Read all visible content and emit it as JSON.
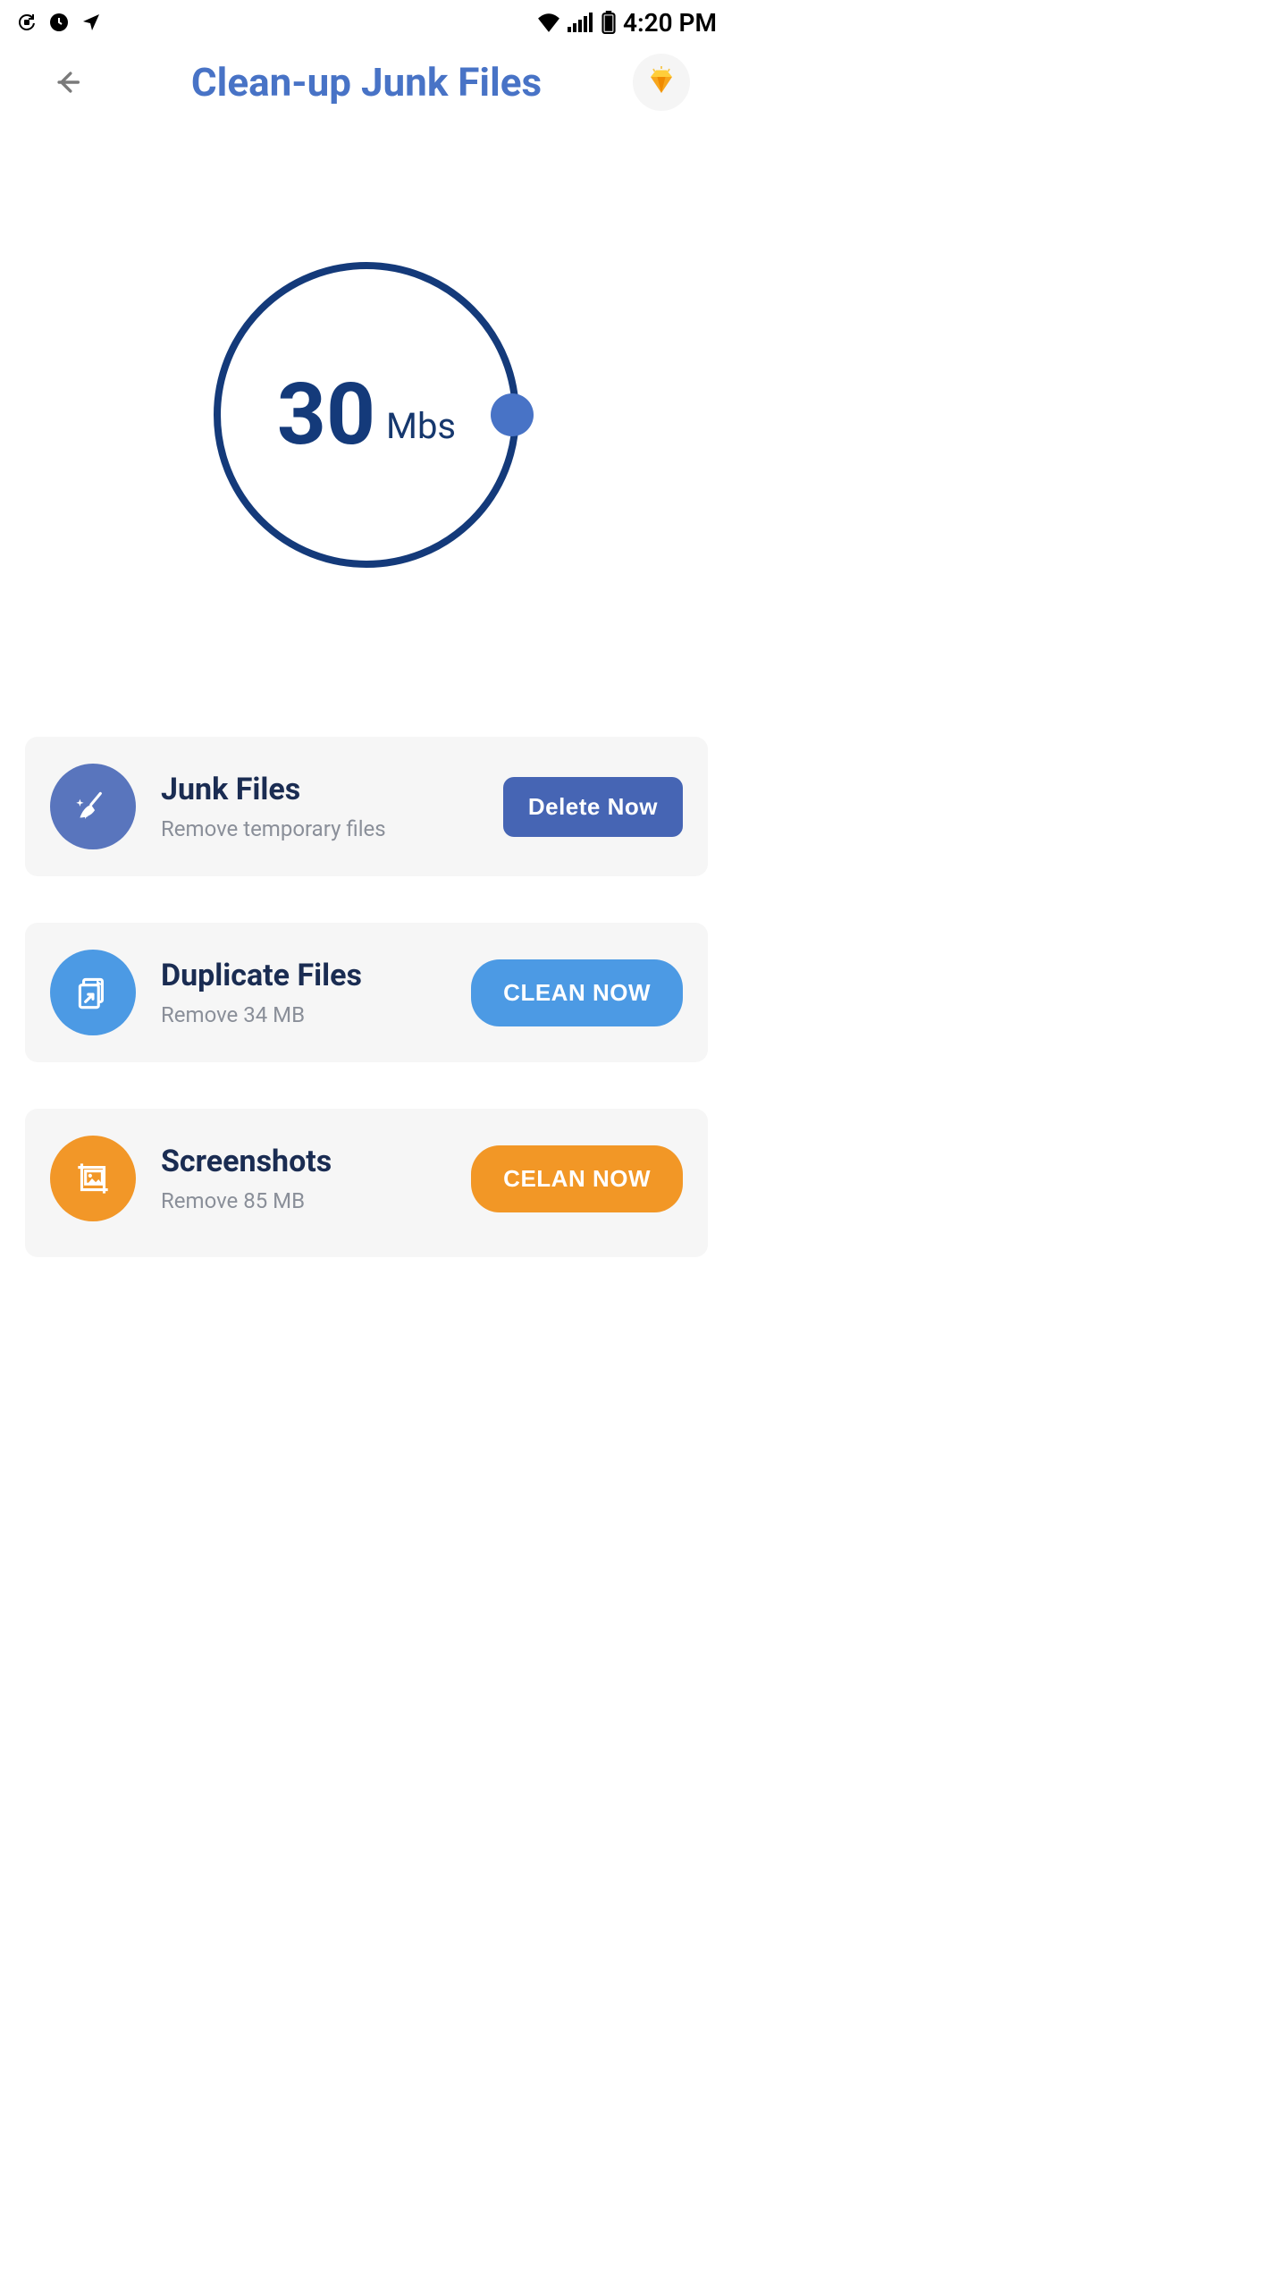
{
  "status_bar": {
    "time": "4:20 PM"
  },
  "header": {
    "title": "Clean-up Junk Files"
  },
  "gauge": {
    "value": "30",
    "unit": "Mbs"
  },
  "cards": [
    {
      "title": "Junk Files",
      "sub": "Remove temporary files",
      "button": "Delete Now"
    },
    {
      "title": "Duplicate Files",
      "sub": "Remove 34 MB",
      "button": "CLEAN NOW"
    },
    {
      "title": "Screenshots",
      "sub": "Remove 85 MB",
      "button": "CELAN NOW"
    }
  ]
}
